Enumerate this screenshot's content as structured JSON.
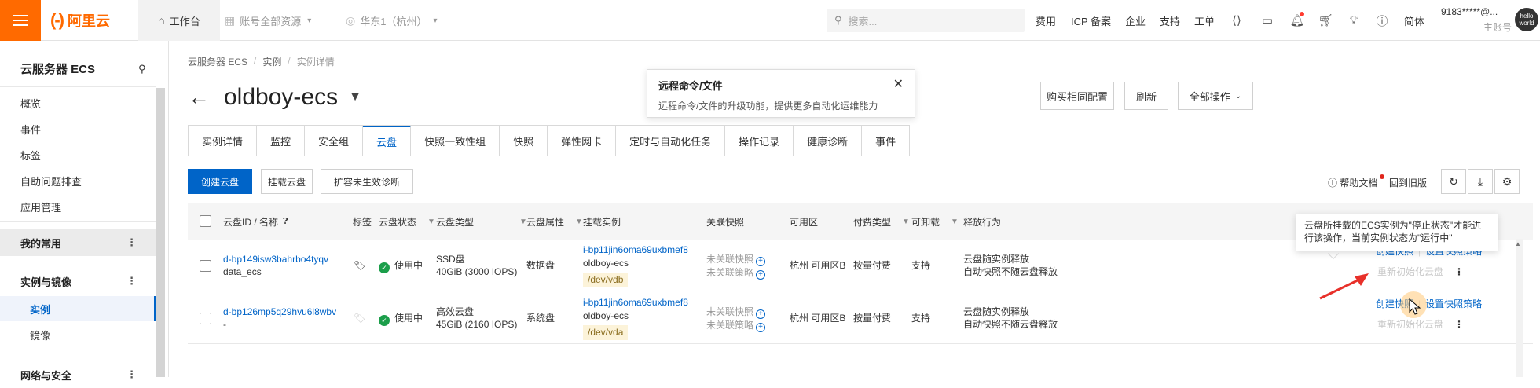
{
  "topbar": {
    "logo_mark": "(-)",
    "logo_text": "阿里云",
    "workspace": "工作台",
    "resources": "账号全部资源",
    "region": "华东1（杭州）",
    "search_placeholder": "搜索...",
    "links": [
      "费用",
      "ICP 备案",
      "企业",
      "支持",
      "工单"
    ],
    "lang": "简体",
    "account_id": "9183*****@...",
    "account_role": "主账号",
    "avatar_text": "hello world"
  },
  "sidebar": {
    "title": "云服务器 ECS",
    "items": [
      "概览",
      "事件",
      "标签",
      "自助问题排查",
      "应用管理"
    ],
    "group_common": "我的常用",
    "group_instances": "实例与镜像",
    "sub_items": [
      "实例",
      "镜像"
    ],
    "group_network": "网络与安全"
  },
  "breadcrumb": [
    "云服务器 ECS",
    "实例",
    "实例详情"
  ],
  "page": {
    "title": "oldboy-ecs",
    "header_buttons": [
      "购买相同配置",
      "刷新",
      "全部操作"
    ]
  },
  "popover": {
    "title": "远程命令/文件",
    "body": "远程命令/文件的升级功能，提供更多自动化运维能力"
  },
  "tabs": [
    "实例详情",
    "监控",
    "安全组",
    "云盘",
    "快照一致性组",
    "快照",
    "弹性网卡",
    "定时与自动化任务",
    "操作记录",
    "健康诊断",
    "事件"
  ],
  "active_tab": "云盘",
  "toolbar": {
    "create": "创建云盘",
    "mount": "挂载云盘",
    "expand_diag": "扩容未生效诊断",
    "help": "帮助文档",
    "old_version": "回到旧版"
  },
  "table": {
    "headers": [
      "云盘ID / 名称",
      "标签",
      "云盘状态",
      "云盘类型",
      "云盘属性",
      "挂载实例",
      "关联快照",
      "可用区",
      "付费类型",
      "可卸载",
      "释放行为"
    ],
    "rows": [
      {
        "id": "d-bp149isw3bahrbo4tyqv",
        "name": "data_ecs",
        "status": "使用中",
        "type": "SSD盘",
        "spec": "40GiB (3000 IOPS)",
        "attr": "数据盘",
        "instance_id": "i-bp11jin6oma69uxbmef8",
        "instance_name": "oldboy-ecs",
        "device": "/dev/vdb",
        "snap1": "未关联快照",
        "snap2": "未关联策略",
        "zone": "杭州 可用区B",
        "billing": "按量付费",
        "detachable": "支持",
        "release1": "云盘随实例释放",
        "release2": "自动快照不随云盘释放",
        "op1": "创建快照",
        "op2": "设置快照策略",
        "op3": "重新初始化云盘"
      },
      {
        "id": "d-bp126mp5q29hvu6l8wbv",
        "name": "-",
        "status": "使用中",
        "type": "高效云盘",
        "spec": "45GiB (2160 IOPS)",
        "attr": "系统盘",
        "instance_id": "i-bp11jin6oma69uxbmef8",
        "instance_name": "oldboy-ecs",
        "device": "/dev/vda",
        "snap1": "未关联快照",
        "snap2": "未关联策略",
        "zone": "杭州 可用区B",
        "billing": "按量付费",
        "detachable": "支持",
        "release1": "云盘随实例释放",
        "release2": "自动快照不随云盘释放",
        "op1": "创建快照",
        "op2": "设置快照策略",
        "op3": "重新初始化云盘"
      }
    ]
  },
  "tooltip": "云盘所挂载的ECS实例为\"停止状态\"才能进行该操作，当前实例状态为\"运行中\"",
  "colors": {
    "brand": "#ff6a00",
    "accent": "#0064c8",
    "ok": "#1b9e4a"
  }
}
